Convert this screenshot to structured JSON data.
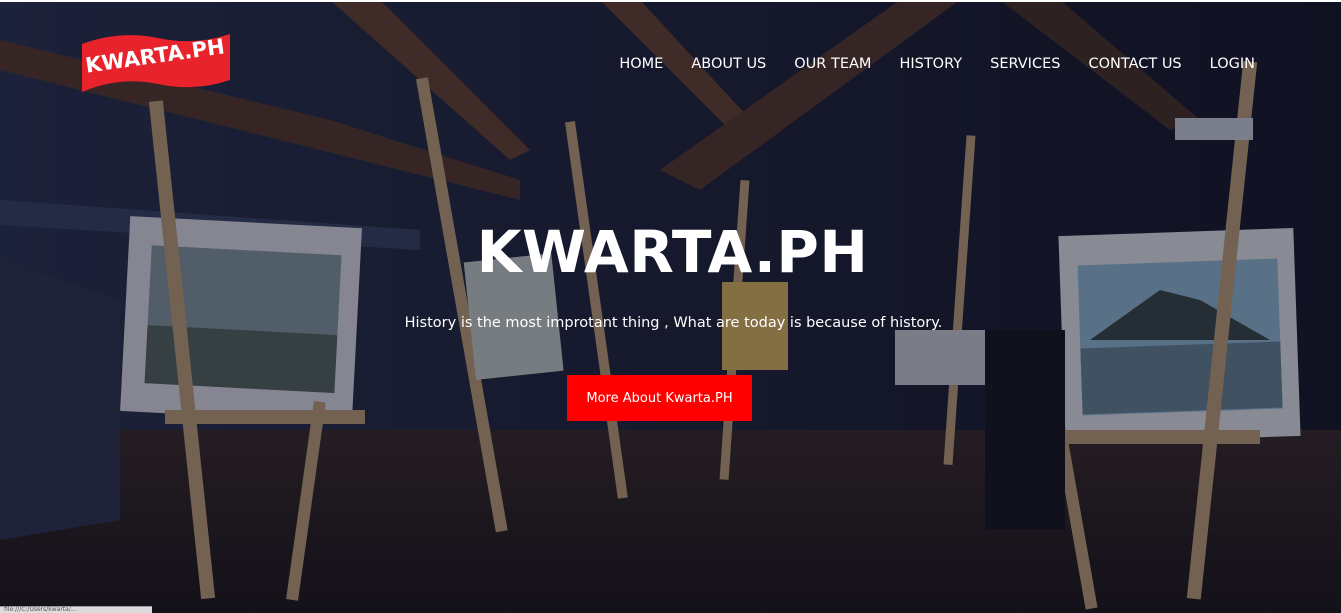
{
  "brand": {
    "logo_text": "KWARTA.PH",
    "logo_color": "#e8232c"
  },
  "nav": {
    "items": [
      {
        "label": "HOME"
      },
      {
        "label": "ABOUT US"
      },
      {
        "label": "OUR TEAM"
      },
      {
        "label": "HISTORY"
      },
      {
        "label": "SERVICES"
      },
      {
        "label": "CONTACT US"
      },
      {
        "label": "LOGIN"
      }
    ]
  },
  "hero": {
    "title": "KWARTA.PH",
    "subtitle": "History is the most improtant thing , What are today is because of history.",
    "cta_label": "More About Kwarta.PH",
    "cta_color": "#ff0000",
    "background_description_icon": "art-gallery-easels-photo"
  },
  "status_bar": {
    "text": "file:///C:/Users/kwarta/..."
  }
}
